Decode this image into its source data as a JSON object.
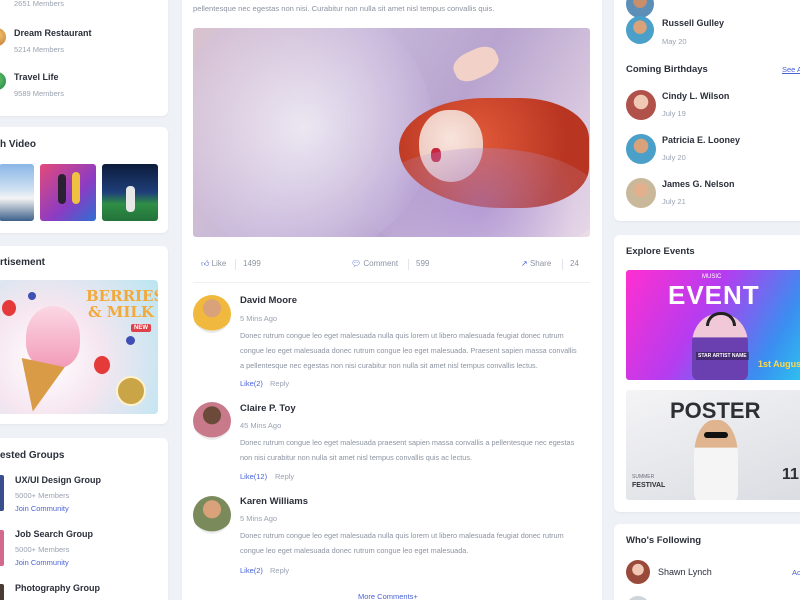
{
  "left": {
    "groups_top": [
      {
        "members": "2651 Members"
      },
      {
        "name": "Dream Restaurant",
        "members": "5214 Members"
      },
      {
        "name": "Travel Life",
        "members": "9589 Members"
      }
    ],
    "video_title": "h Video",
    "ad_title": "rtisement",
    "ad": {
      "headline": "BERRIES & MILK",
      "tag": "NEW"
    },
    "suggested_title": "ested Groups",
    "suggested": [
      {
        "name": "UX/UI Design Group",
        "members": "5000+ Members",
        "action": "Join Community"
      },
      {
        "name": "Job Search Group",
        "members": "5000+ Members",
        "action": "Join Community"
      },
      {
        "name": "Photography Group"
      }
    ]
  },
  "post": {
    "text_line": "pellentesque nec egestas non nisi. Curabitur non nulla sit amet nisl tempus convallis quis.",
    "like_label": "Like",
    "like_count": "1499",
    "comment_label": "Comment",
    "comment_count": "599",
    "share_label": "Share",
    "share_count": "24",
    "comments": [
      {
        "name": "David Moore",
        "time": "5 Mins Ago",
        "lines": [
          "Donec rutrum congue leo eget malesuada nulla quis lorem ut libero malesuada feugiat donec rutrum",
          "congue leo eget malesuada donec rutrum congue leo eget malesuada. Praesent sapien massa convallis",
          "a pellentesque nec egestas non nisi curabitur non nulla sit amet nisl tempus convallis lectus."
        ],
        "like": "Like(2)",
        "reply": "Reply"
      },
      {
        "name": "Claire P. Toy",
        "time": "45 Mins Ago",
        "lines": [
          "Donec rutrum congue leo eget malesuada praesent sapien massa convallis a pellentesque nec egestas",
          "non nisi curabitur non nulla sit amet nisl tempus convallis quis ac lectus."
        ],
        "like": "Like(12)",
        "reply": "Reply"
      },
      {
        "name": "Karen Williams",
        "time": "5 Mins Ago",
        "lines": [
          "Donec rutrum congue leo eget malesuada nulla quis lorem ut libero malesuada feugiat donec rutrum",
          "congue leo eget malesuada donec rutrum congue leo eget malesuada."
        ],
        "like": "Like(2)",
        "reply": "Reply"
      }
    ],
    "more_comments": "More Comments+"
  },
  "right": {
    "top_person": {
      "name": "Russell Gulley",
      "date": "May 20"
    },
    "birthdays_title": "Coming Birthdays",
    "see_all": "See A",
    "birthdays": [
      {
        "name": "Cindy L. Wilson",
        "date": "July 19"
      },
      {
        "name": "Patricia E. Looney",
        "date": "July 20"
      },
      {
        "name": "James G. Nelson",
        "date": "July 21"
      }
    ],
    "events_title": "Explore Events",
    "event1": {
      "music": "MUSIC",
      "title": "EVENT",
      "artist": "STAR ARTIST NAME",
      "date": "1st August"
    },
    "event2": {
      "title": "POSTER",
      "label": "SUMMER",
      "festival": "FESTIVAL",
      "number": "11"
    },
    "following_title": "Who's Following",
    "following": [
      {
        "name": "Shawn Lynch",
        "action": "Ac"
      }
    ]
  },
  "colors": {
    "accent": "#4a63d6",
    "bg": "#eef1f6",
    "event_magenta": "#e83ad8",
    "event_blue": "#3a8ef0"
  }
}
